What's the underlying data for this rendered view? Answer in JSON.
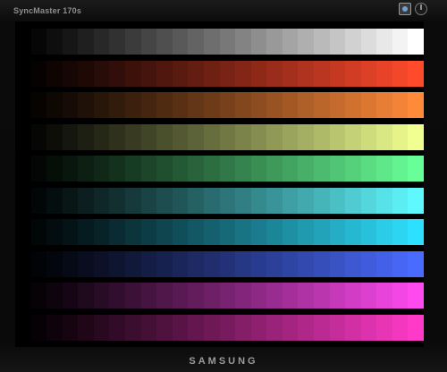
{
  "monitor": {
    "model_label": "SyncMaster 170s",
    "brand_label": "SAMSUNG"
  },
  "test_pattern": {
    "steps": 26,
    "bands": [
      {
        "name": "white",
        "color": "#ffffff"
      },
      {
        "name": "red",
        "color": "#ff4a2c"
      },
      {
        "name": "orange",
        "color": "#ff8a3a"
      },
      {
        "name": "yellow-green",
        "color": "#f0ff90"
      },
      {
        "name": "green",
        "color": "#68ff98"
      },
      {
        "name": "cyan",
        "color": "#60f8ff"
      },
      {
        "name": "sky-blue",
        "color": "#2ee0ff"
      },
      {
        "name": "blue",
        "color": "#4a6bff"
      },
      {
        "name": "magenta",
        "color": "#ff4af0"
      },
      {
        "name": "pink",
        "color": "#ff3ac8"
      }
    ]
  }
}
